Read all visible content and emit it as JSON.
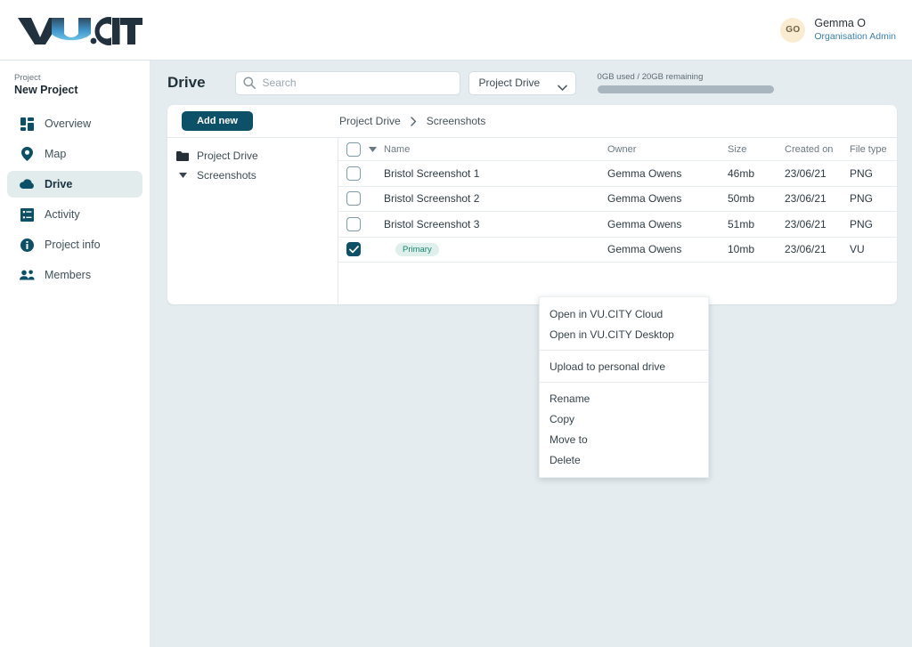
{
  "brand": {
    "logo_text": "VU.CITY",
    "accent": "#3aa0d8",
    "dark": "#21323e"
  },
  "user": {
    "initials": "GO",
    "name": "Gemma O",
    "role": "Organisation Admin"
  },
  "sidebar": {
    "project_label": "Project",
    "project_name": "New Project",
    "items": [
      {
        "label": "Overview",
        "icon": "grid-icon",
        "active": false
      },
      {
        "label": "Map",
        "icon": "pin-icon",
        "active": false
      },
      {
        "label": "Drive",
        "icon": "cloud-icon",
        "active": true
      },
      {
        "label": "Activity",
        "icon": "list-icon",
        "active": false
      },
      {
        "label": "Project info",
        "icon": "info-icon",
        "active": false
      },
      {
        "label": "Members",
        "icon": "people-icon",
        "active": false
      }
    ]
  },
  "header": {
    "title": "Drive",
    "search_placeholder": "Search",
    "search_value": "",
    "drive_select": "Project Drive",
    "storage_text": "0GB used / 20GB remaining",
    "storage_used_percent": 0
  },
  "toolbar": {
    "add_new_label": "Add new"
  },
  "breadcrumb": {
    "root": "Project Drive",
    "separator": "›",
    "current": "Screenshots"
  },
  "tree": [
    {
      "label": "Project Drive",
      "icon": "folder-icon"
    },
    {
      "label": "Screenshots",
      "icon": "caret-down-icon"
    }
  ],
  "table": {
    "columns": [
      "Name",
      "Owner",
      "Size",
      "Created on",
      "File type"
    ],
    "rows": [
      {
        "checked": false,
        "name": "Bristol Screenshot 1",
        "badge": "",
        "owner": "Gemma Owens",
        "size": "46mb",
        "created": "23/06/21",
        "type": "PNG"
      },
      {
        "checked": false,
        "name": "Bristol Screenshot 2",
        "badge": "",
        "owner": "Gemma Owens",
        "size": "50mb",
        "created": "23/06/21",
        "type": "PNG"
      },
      {
        "checked": false,
        "name": "Bristol Screenshot 3",
        "badge": "",
        "owner": "Gemma Owens",
        "size": "51mb",
        "created": "23/06/21",
        "type": "PNG"
      },
      {
        "checked": true,
        "name": "",
        "badge": "Primary",
        "owner": "Gemma Owens",
        "size": "10mb",
        "created": "23/06/21",
        "type": "VU"
      }
    ]
  },
  "context_menu": {
    "groups": [
      [
        "Open in VU.CITY Cloud",
        "Open in VU.CITY Desktop"
      ],
      [
        "Upload to personal drive"
      ],
      [
        "Rename",
        "Copy",
        "Move to",
        "Delete"
      ]
    ]
  }
}
